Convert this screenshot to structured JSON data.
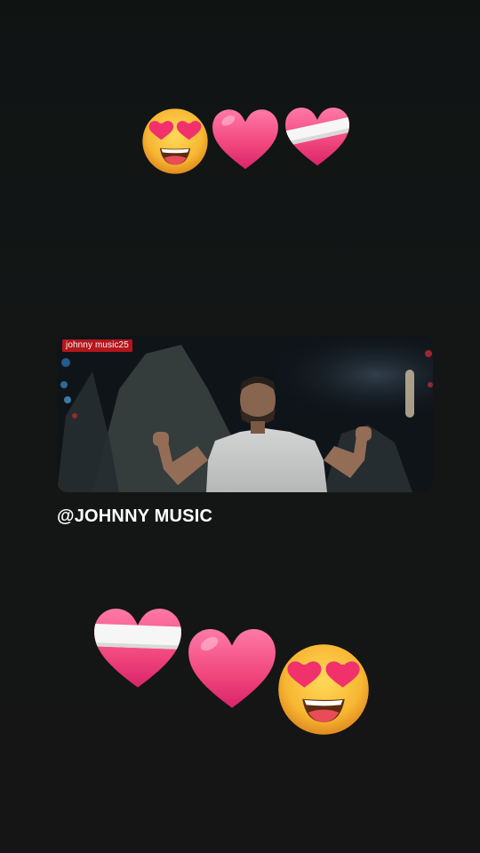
{
  "video": {
    "watermark": "johnny music25"
  },
  "caption": {
    "handle": "@JOHNNY MUSIC"
  },
  "icons": {
    "top_row": [
      "heart-eyes-face-icon",
      "pink-heart-icon",
      "bandaged-heart-icon"
    ],
    "bottom_row": [
      "bandaged-heart-icon",
      "pink-heart-icon",
      "heart-eyes-face-icon"
    ]
  },
  "colors": {
    "background": "#121212",
    "heart_pink": "#f0457d",
    "face_yellow": "#f7b733",
    "watermark_bg": "#b3161b"
  }
}
